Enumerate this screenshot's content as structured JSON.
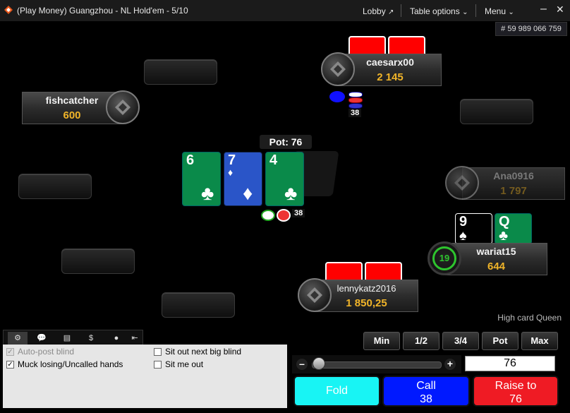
{
  "window": {
    "title": "(Play Money) Guangzhou -  NL  Hold'em - 5/10",
    "lobby_label": "Lobby",
    "table_options_label": "Table options",
    "menu_label": "Menu",
    "hand_id": "# 59 989 066 759"
  },
  "players": [
    {
      "name": "caesarx00",
      "stack": "2 145",
      "bet": "38"
    },
    {
      "name": "fishcatcher",
      "stack": "600"
    },
    {
      "name": "Ana0916",
      "stack": "1 797"
    },
    {
      "name": "wariat15",
      "stack": "644",
      "timer": "19"
    },
    {
      "name": "lennykatz2016",
      "stack": "1 850,25"
    }
  ],
  "hero_cards": [
    {
      "rank": "9",
      "suit": "♠",
      "color": "#000000"
    },
    {
      "rank": "Q",
      "suit": "♣",
      "color": "#0a8a4a"
    }
  ],
  "board": {
    "pot_label": "Pot: 76",
    "pot_chips": "38",
    "cards": [
      {
        "rank": "6",
        "suit": "♣",
        "color": "#0a8a4a"
      },
      {
        "rank": "7",
        "suit": "♦",
        "color": "#2a55c8"
      },
      {
        "rank": "4",
        "suit": "♣",
        "color": "#0a8a4a"
      }
    ]
  },
  "hand_strength": "High card Queen",
  "bet_presets": [
    "Min",
    "1/2",
    "3/4",
    "Pot",
    "Max"
  ],
  "bet_amount": "76",
  "actions": {
    "fold": "Fold",
    "call_label": "Call",
    "call_amount": "38",
    "raise_label": "Raise to",
    "raise_amount": "76"
  },
  "options": {
    "auto_post_blind": "Auto-post blind",
    "muck_losing": "Muck losing/Uncalled hands",
    "sit_out_next_bb": "Sit out next big blind",
    "sit_me_out": "Sit me out"
  },
  "colors": {
    "fold": "#18f4f4",
    "call": "#0019ff",
    "raise": "#ef1b24",
    "stack": "#f0b429"
  }
}
